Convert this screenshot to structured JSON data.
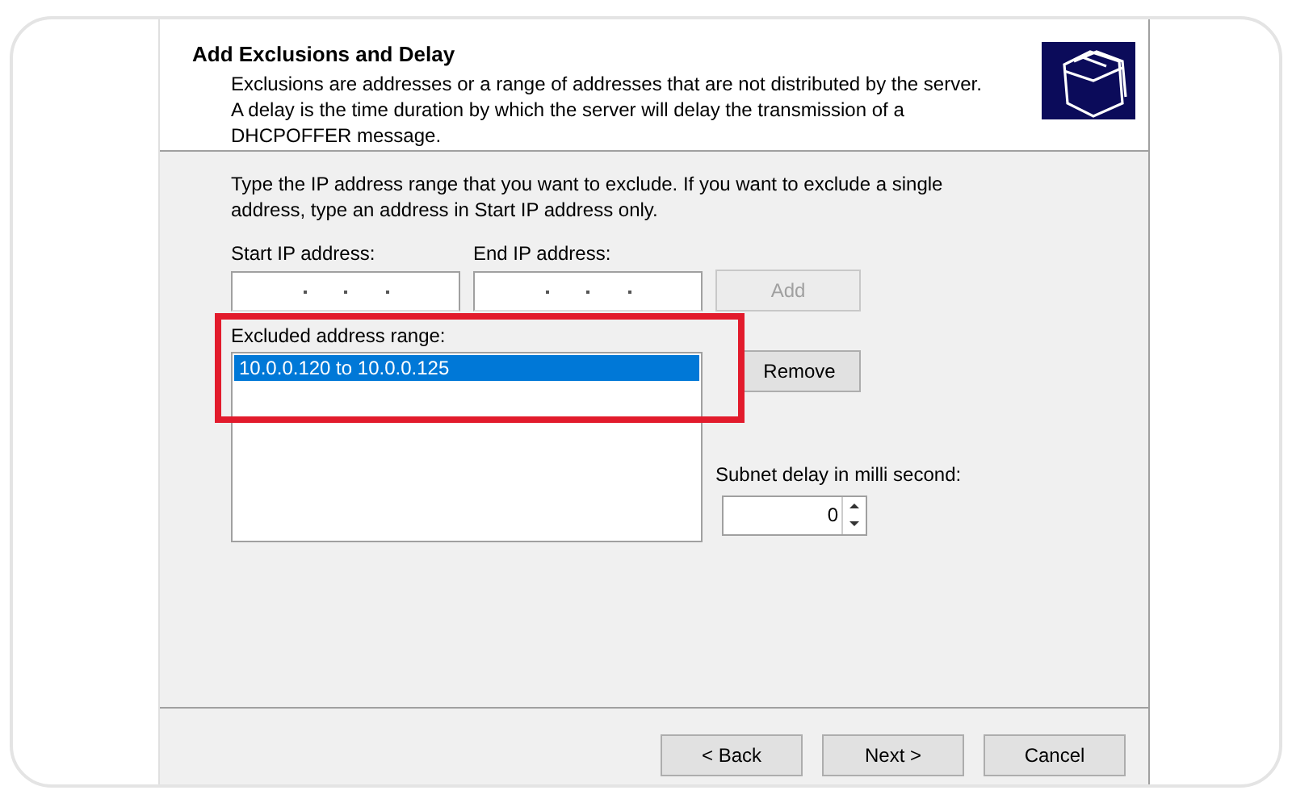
{
  "header": {
    "title": "Add Exclusions and Delay",
    "description": "Exclusions are addresses or a range of addresses that are not distributed by the server. A delay is the time duration by which the server will delay the transmission of a DHCPOFFER message."
  },
  "instructions": "Type the IP address range that you want to exclude. If you want to exclude a single address, type an address in Start IP address only.",
  "start_ip": {
    "label": "Start IP address:"
  },
  "end_ip": {
    "label": "End IP address:"
  },
  "add_button": {
    "label": "Add",
    "disabled": true
  },
  "excluded": {
    "label": "Excluded address range:",
    "items": [
      {
        "text": "10.0.0.120 to 10.0.0.125",
        "selected": true
      }
    ]
  },
  "remove_button": {
    "label": "Remove",
    "disabled": false
  },
  "delay": {
    "label": "Subnet delay in milli second:",
    "value": "0"
  },
  "buttons": [
    {
      "label": "< Back"
    },
    {
      "label": "Next >"
    },
    {
      "label": "Cancel"
    }
  ]
}
